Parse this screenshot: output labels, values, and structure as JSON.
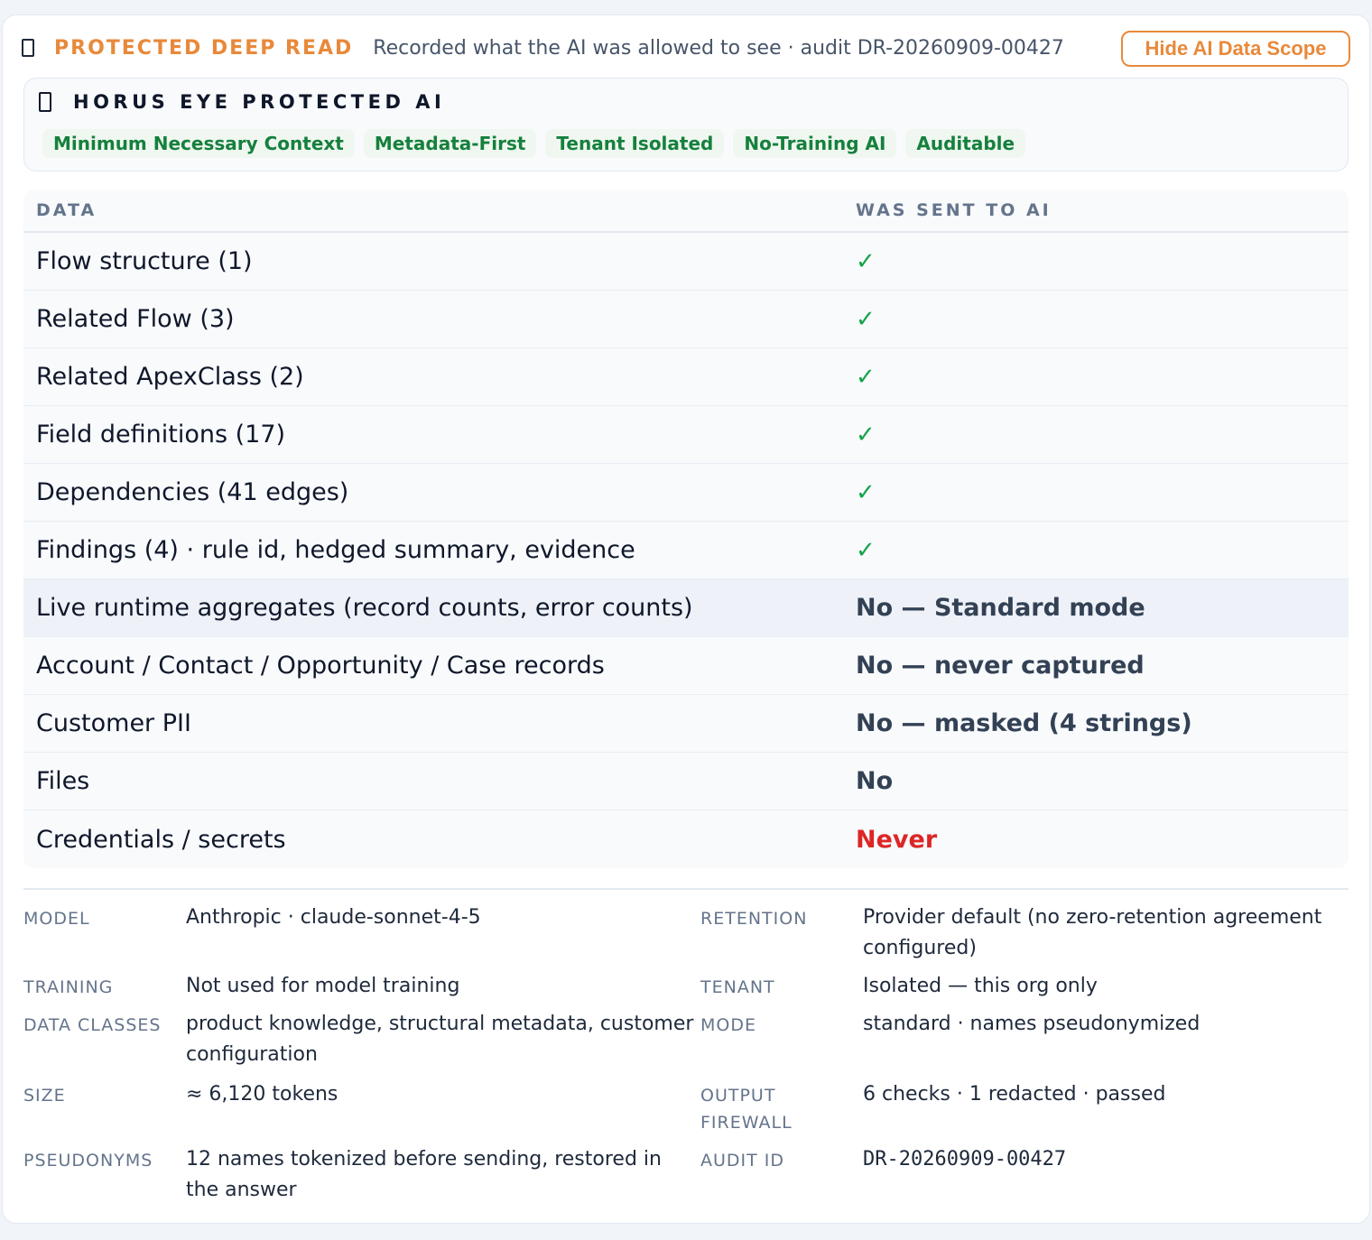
{
  "header": {
    "kicker": "PROTECTED DEEP READ",
    "subtitle": "Recorded what the AI was allowed to see · audit DR-20260909-00427",
    "hide_button": "Hide AI Data Scope"
  },
  "protected": {
    "title": "HORUS EYE PROTECTED AI",
    "pills": [
      "Minimum Necessary Context",
      "Metadata-First",
      "Tenant Isolated",
      "No-Training AI",
      "Auditable"
    ]
  },
  "table": {
    "headers": [
      "DATA",
      "WAS SENT TO AI"
    ],
    "rows": [
      {
        "data": "Flow structure (1)",
        "sent": "✓"
      },
      {
        "data": "Related Flow (3)",
        "sent": "✓"
      },
      {
        "data": "Related ApexClass (2)",
        "sent": "✓"
      },
      {
        "data": "Field definitions (17)",
        "sent": "✓"
      },
      {
        "data": "Dependencies (41 edges)",
        "sent": "✓"
      },
      {
        "data": "Findings (4) · rule id, hedged summary, evidence",
        "sent": "✓"
      },
      {
        "data": "Live runtime aggregates (record counts, error counts)",
        "sent": "No — Standard mode"
      },
      {
        "data": "Account / Contact / Opportunity / Case records",
        "sent": "No — never captured"
      },
      {
        "data": "Customer PII",
        "sent": "No — masked (4 strings)"
      },
      {
        "data": "Files",
        "sent": "No"
      },
      {
        "data": "Credentials / secrets",
        "sent": "Never"
      }
    ]
  },
  "meta": {
    "model_label": "MODEL",
    "model": "Anthropic · claude-sonnet-4-5",
    "retention_label": "RETENTION",
    "retention": "Provider default (no zero-retention agreement configured)",
    "training_label": "TRAINING",
    "training": "Not used for model training",
    "tenant_label": "TENANT",
    "tenant": "Isolated — this org only",
    "classes_label": "DATA CLASSES",
    "classes": "product knowledge, structural metadata, customer configuration",
    "mode_label": "MODE",
    "mode": "standard · names pseudonymized",
    "size_label": "SIZE",
    "size": "≈ 6,120 tokens",
    "firewall_label": "OUTPUT FIREWALL",
    "firewall": "6 checks · 1 redacted · passed",
    "pseudonyms_label": "PSEUDONYMS",
    "pseudonyms": "12 names tokenized before sending, restored in the answer",
    "audit_label": "AUDIT ID",
    "audit": "DR-20260909-00427"
  },
  "colors": {
    "accent": "#e8893a",
    "pill_text": "#15803d",
    "check": "#16a34a",
    "never": "#dc2626"
  }
}
